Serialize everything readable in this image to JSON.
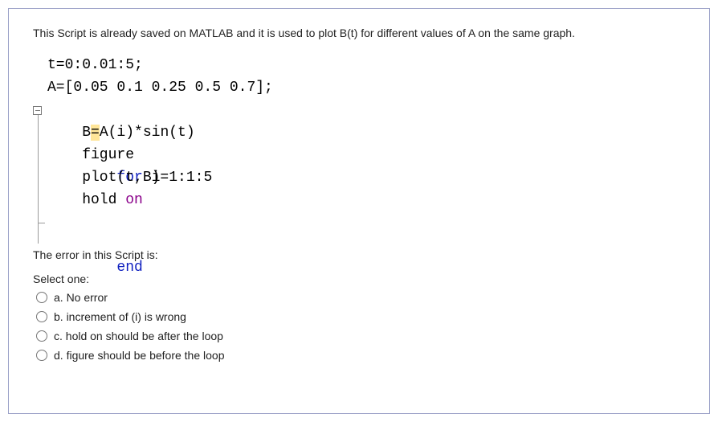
{
  "intro": "This Script is already saved on MATLAB and it is used to plot B(t) for different values of A on the same graph.",
  "code": {
    "l1": "t=0:0.01:5;",
    "l2": "A=[0.05 0.1 0.25 0.5 0.7];",
    "l3_kw": "for",
    "l3_rest": " i=1:1:5",
    "l4_a": "    B",
    "l4_eq": "=",
    "l4_b": "A(i)*sin(t)",
    "l5": "    figure",
    "l6": "    plot(t,B)",
    "l7a": "    hold ",
    "l7b": "on",
    "l8": "end"
  },
  "prompt": "The error in this Script is:",
  "select_one": "Select one:",
  "options": [
    {
      "key": "a",
      "label": "a. No error"
    },
    {
      "key": "b",
      "label": "b. increment of (i) is wrong"
    },
    {
      "key": "c",
      "label": "c. hold on should be after the loop"
    },
    {
      "key": "d",
      "label": "d. figure should be before the loop"
    }
  ]
}
